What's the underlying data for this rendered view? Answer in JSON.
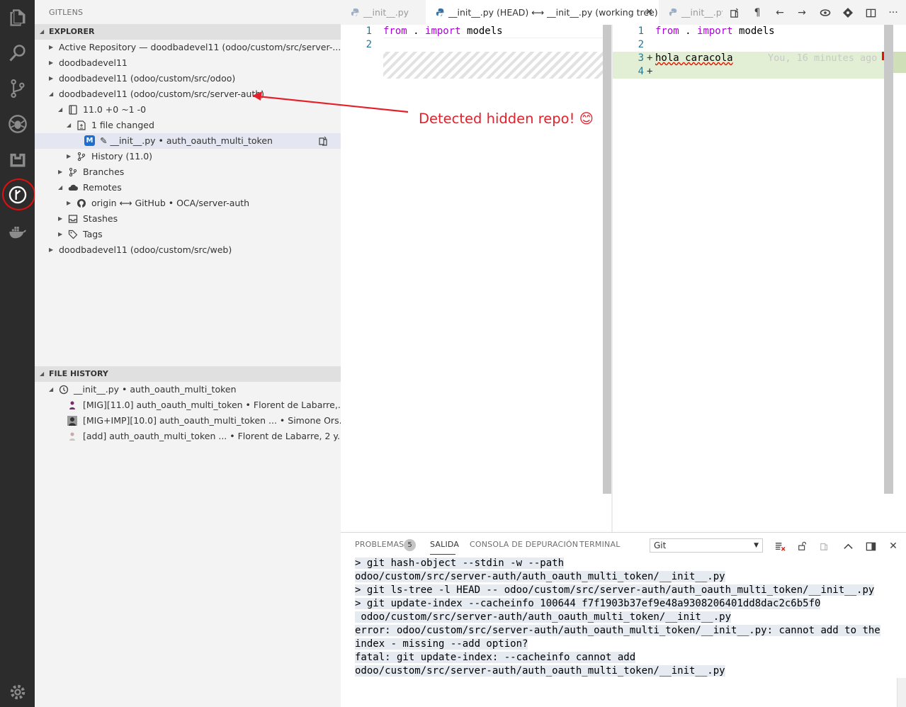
{
  "sidebar": {
    "title": "GITLENS",
    "explorer_title": "EXPLORER",
    "file_history_title": "FILE HISTORY",
    "explorer_rows": [
      "Active Repository  —  doodbadevel11 (odoo/custom/src/server-...",
      "doodbadevel11",
      "doodbadevel11 (odoo/custom/src/odoo)",
      "doodbadevel11 (odoo/custom/src/server-auth)",
      "11.0  +0 ~1 -0",
      "1 file changed",
      "✎  __init__.py  •  auth_oauth_multi_token",
      "History (11.0)",
      "Branches",
      "Remotes",
      "origin  ⟷  GitHub  •  OCA/server-auth",
      "Stashes",
      "Tags",
      "doodbadevel11 (odoo/custom/src/web)"
    ],
    "modified_badge": "M",
    "history_rows": [
      "__init__.py  •  auth_oauth_multi_token",
      "[MIG][11.0] auth_oauth_multi_token  •  Florent de Labarre,...",
      "[MIG+IMP][10.0] auth_oauth_multi_token ...  •  Simone Ors...",
      "[add] auth_oauth_multi_token ...  •  Florent de Labarre, 2 y..."
    ]
  },
  "tabs": {
    "tab1": "__init__.py",
    "tab2": "__init__.py (HEAD) ⟷ __init__.py (working tree)",
    "tab3": "__init__.py",
    "close": "✕"
  },
  "editor": {
    "left_lines": [
      "1",
      "2"
    ],
    "right_lines": [
      "1",
      "2",
      "3",
      "4"
    ],
    "code_from": "from",
    "code_dot": " . ",
    "code_import": "import",
    "code_models": " models",
    "added_text": "hola caracola",
    "blame": "You, 16 minutes ago",
    "plus": "+"
  },
  "annotation": {
    "text": "Detected hidden repo! 😊"
  },
  "panel": {
    "tabs": [
      "PROBLEMAS",
      "SALIDA",
      "CONSOLA DE DEPURACIÓN",
      "TERMINAL"
    ],
    "problems_count": "5",
    "channel": "Git",
    "output": [
      "> git hash-object --stdin -w --path",
      "odoo/custom/src/server-auth/auth_oauth_multi_token/__init__.py",
      "> git ls-tree -l HEAD -- odoo/custom/src/server-auth/auth_oauth_multi_token/__init__.py",
      "> git update-index --cacheinfo 100644 f7f1903b37ef9e48a9308206401dd8dac2c6b5f0",
      " odoo/custom/src/server-auth/auth_oauth_multi_token/__init__.py",
      "error: odoo/custom/src/server-auth/auth_oauth_multi_token/__init__.py: cannot add to the",
      "index - missing --add option?",
      "fatal: git update-index: --cacheinfo cannot add",
      "odoo/custom/src/server-auth/auth_oauth_multi_token/__init__.py"
    ]
  }
}
